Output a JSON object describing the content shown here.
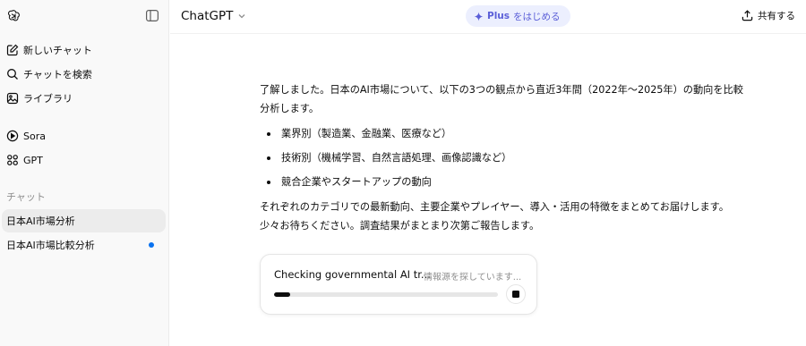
{
  "sidebar": {
    "nav": [
      {
        "label": "新しいチャット",
        "icon": "new-chat-icon"
      },
      {
        "label": "チャットを検索",
        "icon": "search-icon"
      },
      {
        "label": "ライブラリ",
        "icon": "library-icon"
      },
      {
        "label": "Sora",
        "icon": "play-icon"
      },
      {
        "label": "GPT",
        "icon": "grid-icon"
      }
    ],
    "section_label": "チャット",
    "chats": [
      {
        "label": "日本AI市場分析",
        "active": true
      },
      {
        "label": "日本AI市場比較分析",
        "unread": true
      }
    ]
  },
  "header": {
    "model": "ChatGPT",
    "plus_strong": "Plus",
    "plus_rest": "をはじめる",
    "share": "共有する"
  },
  "message": {
    "intro_lines": [
      "了解しました。日本のAI市場について、以下の3つの観点から直近3年間（2022年〜2025年）の動向を比較",
      "分析します。"
    ],
    "bullets": [
      "業界別（製造業、金融業、医療など）",
      "技術別（機械学習、自然言語処理、画像認識など）",
      "競合企業やスタートアップの動向"
    ],
    "outro_lines": [
      "それぞれのカテゴリでの最新動向、主要企業やプレイヤー、導入・活用の特徴をまとめてお届けします。",
      "少々お待ちください。調査結果がまとまり次第ご報告します。"
    ]
  },
  "progress": {
    "title": "Checking governmental AI tr...",
    "status": "情報源を探しています...",
    "fraction": 0.07
  },
  "colors": {
    "accent": "#5b5fd8",
    "plus_bg": "#eceffe",
    "unread_dot": "#0a72ef",
    "sidebar_bg": "#f9f9f9"
  }
}
